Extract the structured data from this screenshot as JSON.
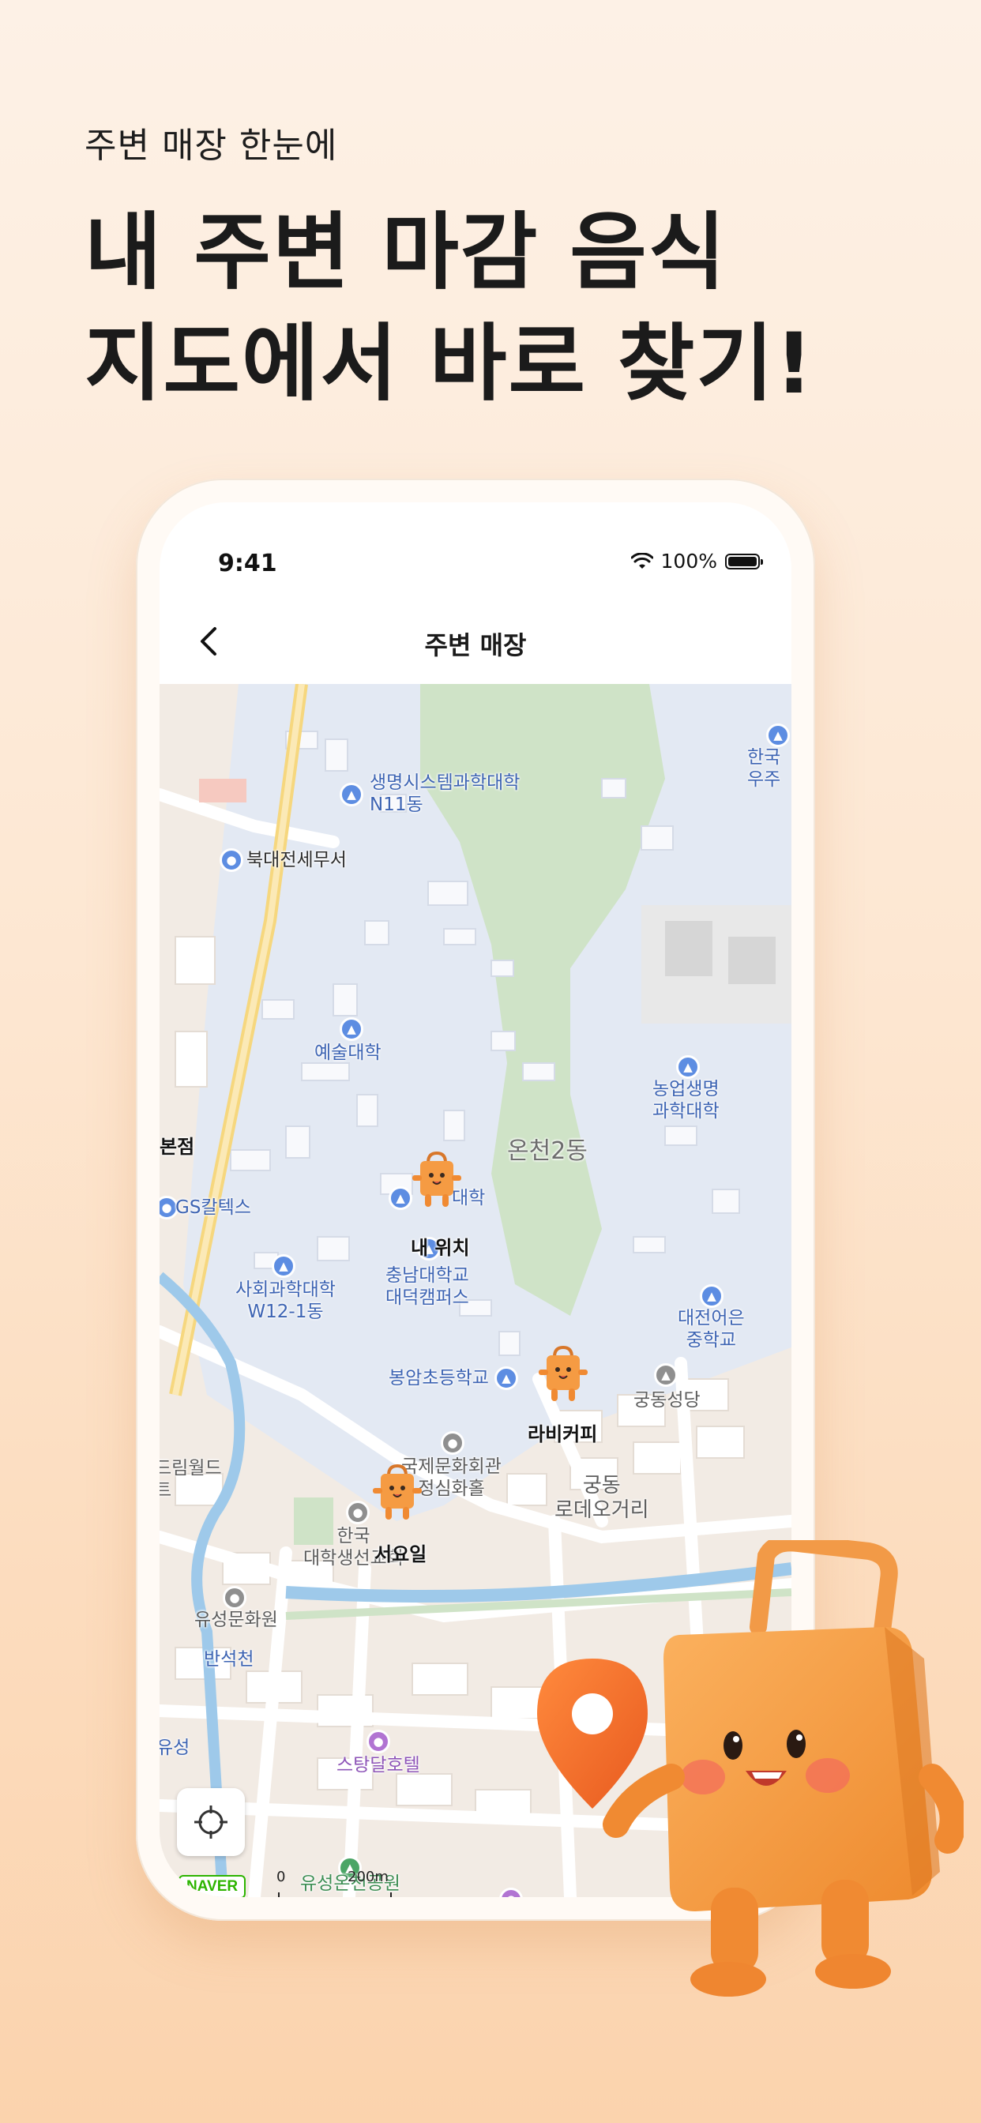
{
  "headline": {
    "small": "주변 매장 한눈에",
    "line1": "내 주변 마감 음식",
    "line2": "지도에서 바로 찾기!"
  },
  "status_bar": {
    "time": "9:41",
    "battery": "100%"
  },
  "nav": {
    "title": "주변 매장"
  },
  "map": {
    "labels": {
      "life_sci": "생명시스템과학대학\nN11동",
      "tax_office": "북대전세무서",
      "arts": "예술대학",
      "agri": "농업생명\n과학대학",
      "district": "온천2동",
      "bonjeom": "본점",
      "gs": "GS칼텍스",
      "univ_partial": "대학",
      "my_location": "내 위치",
      "cnu": "충남대학교\n대덕캠퍼스",
      "social_sci": "사회과학대학\nW12-1동",
      "daejeon_school": "대전어은\n중학교",
      "bongam": "봉암초등학교",
      "gungdong_church": "궁동성당",
      "cafe": "라비커피",
      "intl": "국제문화회관\n정심화홀",
      "gungdong_street": "궁동\n로데오거리",
      "rimworld": "드림월드\n트",
      "korea_univ": "한국\n대학생선교회",
      "seoyoil": "서요일",
      "yuseong_culture": "유성문화원",
      "bansukcheon": "반석천",
      "starlight": "스탕달호텔",
      "yuseong_park": "유성온천공원",
      "top_right": "한국\n우주",
      "yuseong_partial": "유성"
    },
    "scale_label": "200m",
    "scale_zero": "0",
    "logo": "NAVER"
  },
  "colors": {
    "accent": "#f59b43",
    "map_campus": "#e3e9f3",
    "map_park": "#cfe3c7",
    "map_river": "#9ec9ea"
  },
  "icons": {
    "back": "chevron-left-icon",
    "locate": "crosshair-icon",
    "wifi": "wifi-icon",
    "battery": "battery-icon"
  }
}
